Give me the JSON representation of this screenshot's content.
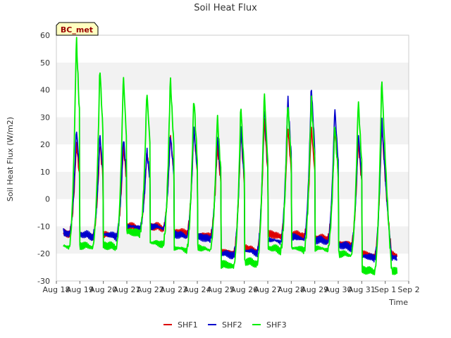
{
  "chart_data": {
    "type": "line",
    "title": "Soil Heat Flux",
    "xlabel": "Time",
    "ylabel": "Soil Heat Flux (W/m2)",
    "ylim": [
      -30,
      60
    ],
    "yticks": [
      -30,
      -20,
      -10,
      0,
      10,
      20,
      30,
      40,
      50,
      60
    ],
    "xlim": [
      "2023-08-18",
      "2023-09-02"
    ],
    "xticks": [
      "Aug 18",
      "Aug 19",
      "Aug 20",
      "Aug 21",
      "Aug 22",
      "Aug 23",
      "Aug 24",
      "Aug 25",
      "Aug 26",
      "Aug 27",
      "Aug 28",
      "Aug 29",
      "Aug 30",
      "Aug 31",
      "Sep 1",
      "Sep 2"
    ],
    "station_label": "BC_met",
    "grid": "horizontal bands",
    "legend_position": "bottom-center",
    "daily_peak_day_offsets": [
      0.85,
      1.85,
      2.85,
      3.85,
      4.85,
      5.85,
      6.85,
      7.85,
      8.85,
      9.85,
      10.85,
      11.85,
      12.85,
      13.85
    ],
    "series": [
      {
        "name": "SHF1",
        "color": "#dd0000",
        "daily_max": [
          21,
          21,
          20,
          18,
          24,
          26,
          20,
          25,
          30,
          27,
          27,
          26,
          22,
          28
        ],
        "daily_min": [
          -13,
          -14,
          -14,
          -11,
          -11,
          -13,
          -14,
          -20,
          -19,
          -14,
          -14,
          -15,
          -17,
          -21
        ]
      },
      {
        "name": "SHF2",
        "color": "#0000cc",
        "daily_max": [
          26,
          24,
          23,
          18,
          24,
          27,
          24,
          27,
          35,
          38,
          42,
          34,
          25,
          30
        ],
        "daily_min": [
          -13,
          -14,
          -14,
          -11,
          -11,
          -14,
          -15,
          -21,
          -20,
          -16,
          -15,
          -16,
          -18,
          -22
        ]
      },
      {
        "name": "SHF3",
        "color": "#00ee00",
        "daily_max": [
          60,
          49,
          46,
          40,
          45,
          38,
          31,
          35,
          40,
          36,
          38,
          28,
          37,
          45
        ],
        "daily_min": [
          -18,
          -18,
          -18,
          -13,
          -17,
          -19,
          -19,
          -25,
          -24,
          -19,
          -19,
          -19,
          -21,
          -27
        ]
      }
    ]
  }
}
